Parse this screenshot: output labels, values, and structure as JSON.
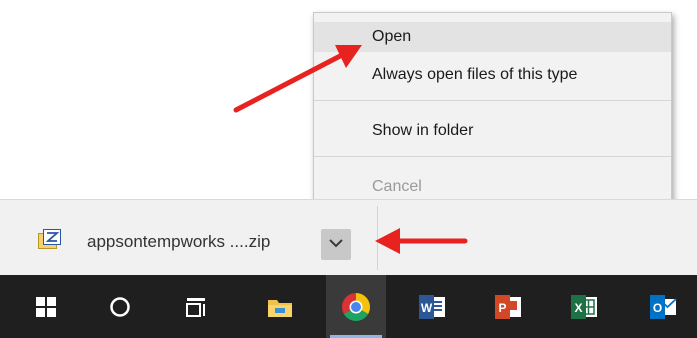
{
  "context_menu": {
    "items": [
      {
        "label": "Open",
        "state": "hover"
      },
      {
        "label": "Always open files of this type",
        "state": "normal"
      },
      {
        "label": "Show in folder",
        "state": "normal"
      },
      {
        "label": "Cancel",
        "state": "disabled"
      }
    ]
  },
  "download_shelf": {
    "file_name": "appsontempworks ....zip",
    "file_icon": "zip-file-icon",
    "menu_icon": "chevron-down-icon"
  },
  "taskbar": {
    "items": [
      {
        "name": "windows-start-icon"
      },
      {
        "name": "cortana-search-icon"
      },
      {
        "name": "task-view-icon"
      },
      {
        "name": "file-explorer-icon"
      },
      {
        "name": "chrome-icon",
        "active": true
      },
      {
        "name": "word-icon"
      },
      {
        "name": "powerpoint-icon"
      },
      {
        "name": "excel-icon"
      },
      {
        "name": "outlook-icon"
      }
    ]
  },
  "colors": {
    "annotation_arrow": "#e8231f",
    "taskbar_bg": "#1f1f1f",
    "word": "#2b5797",
    "powerpoint": "#d24726",
    "excel": "#1e7145",
    "outlook": "#0072c6"
  }
}
